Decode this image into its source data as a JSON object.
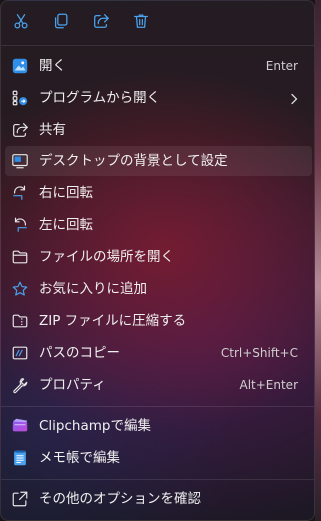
{
  "toolbar": {
    "buttons": [
      {
        "icon": "scissors-icon",
        "tooltip": "cut"
      },
      {
        "icon": "copy-icon",
        "tooltip": "copy"
      },
      {
        "icon": "share-icon",
        "tooltip": "share"
      },
      {
        "icon": "trash-icon",
        "tooltip": "delete"
      }
    ]
  },
  "menu": {
    "items": [
      {
        "label": "開く",
        "shortcut": "Enter",
        "icon": "open-icon"
      },
      {
        "label": "プログラムから開く",
        "shortcut": "",
        "icon": "open-with-icon",
        "submenu": true
      },
      {
        "label": "共有",
        "shortcut": "",
        "icon": "share-icon"
      },
      {
        "label": "デスクトップの背景として設定",
        "shortcut": "",
        "icon": "desktop-background-icon"
      },
      {
        "label": "右に回転",
        "shortcut": "",
        "icon": "rotate-right-icon"
      },
      {
        "label": "左に回転",
        "shortcut": "",
        "icon": "rotate-left-icon"
      },
      {
        "label": "ファイルの場所を開く",
        "shortcut": "",
        "icon": "folder-icon"
      },
      {
        "label": "お気に入りに追加",
        "shortcut": "",
        "icon": "star-icon"
      },
      {
        "label": "ZIP ファイルに圧縮する",
        "shortcut": "",
        "icon": "zip-folder-icon"
      },
      {
        "label": "パスのコピー",
        "shortcut": "Ctrl+Shift+C",
        "icon": "copy-path-icon"
      },
      {
        "label": "プロパティ",
        "shortcut": "Alt+Enter",
        "icon": "wrench-icon"
      }
    ],
    "apps": [
      {
        "label": "Clipchampで編集",
        "icon": "clipchamp-icon"
      },
      {
        "label": "メモ帳で編集",
        "icon": "notepad-icon"
      }
    ],
    "more": {
      "label": "その他のオプションを確認",
      "icon": "more-options-icon"
    }
  },
  "colors": {
    "accent_blue": "#4aa3f0",
    "text": "#f0f0f0",
    "shortcut_text": "#cfcfcf"
  }
}
